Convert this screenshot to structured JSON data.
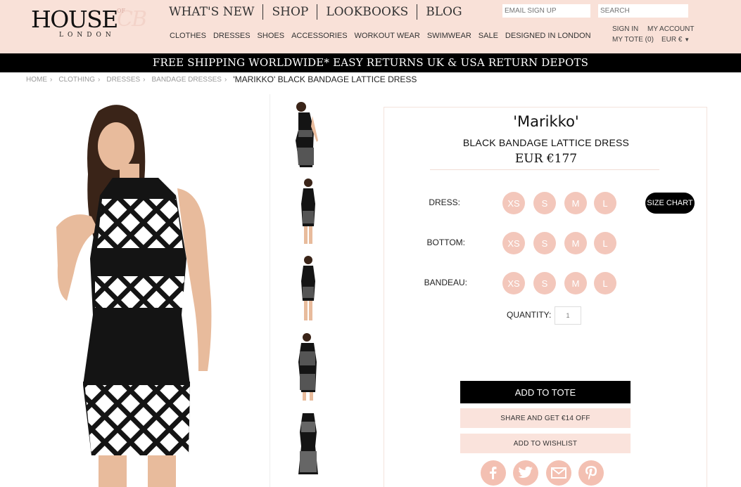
{
  "brand": {
    "house": "HOUSE",
    "of": "OF",
    "cb": "CB",
    "london": "LONDON"
  },
  "mainnav": [
    "WHAT'S NEW",
    "SHOP",
    "LOOKBOOKS",
    "BLOG"
  ],
  "subnav": [
    "CLOTHES",
    "DRESSES",
    "SHOES",
    "ACCESSORIES",
    "WORKOUT WEAR",
    "SWIMWEAR",
    "SALE",
    "DESIGNED IN LONDON"
  ],
  "header": {
    "email_placeholder": "EMAIL SIGN UP",
    "search_placeholder": "SEARCH",
    "sign_in": "SIGN IN",
    "my_account": "MY ACCOUNT",
    "my_tote": "MY TOTE (0)",
    "currency": "EUR €"
  },
  "shipping_bar": "FREE SHIPPING WORLDWIDE* EASY RETURNS UK & USA RETURN DEPOTS",
  "breadcrumb": {
    "items": [
      "HOME",
      "CLOTHING",
      "DRESSES",
      "BANDAGE DRESSES"
    ],
    "current": "'MARIKKO' BLACK BANDAGE LATTICE DRESS"
  },
  "product": {
    "name": "'Marikko'",
    "subtitle": "BLACK BANDAGE LATTICE DRESS",
    "price": "EUR €177",
    "options": [
      {
        "label": "DRESS:",
        "sizes": [
          "XS",
          "S",
          "M",
          "L"
        ]
      },
      {
        "label": "BOTTOM:",
        "sizes": [
          "XS",
          "S",
          "M",
          "L"
        ]
      },
      {
        "label": "BANDEAU:",
        "sizes": [
          "XS",
          "S",
          "M",
          "L"
        ]
      }
    ],
    "size_chart": "SIZE CHART",
    "quantity_label": "QUANTITY:",
    "quantity_value": "1",
    "add_to_tote": "ADD TO TOTE",
    "share": "SHARE AND GET €14 OFF",
    "wishlist": "ADD TO WISHLIST"
  },
  "social": [
    "facebook-icon",
    "twitter-icon",
    "email-icon",
    "pinterest-icon"
  ],
  "colors": {
    "header_bg": "#f9e1d8",
    "accent_pink": "#f3c7bb",
    "button_pink": "#fae3dc",
    "black": "#000000"
  }
}
